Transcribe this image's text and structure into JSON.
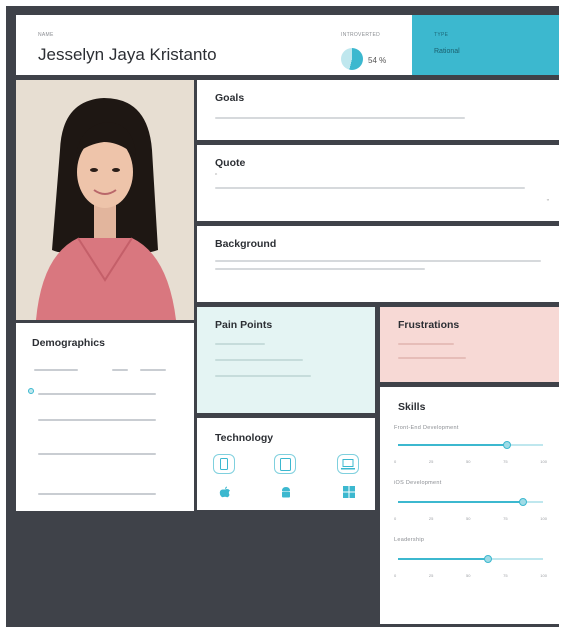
{
  "header": {
    "name_label": "NAME",
    "name": "Jesselyn Jaya Kristanto",
    "percent_label": "INTROVERTED",
    "percent": "54 %",
    "percent_value": 54,
    "type_label": "TYPE",
    "type_value": "Rational"
  },
  "goals": {
    "title": "Goals"
  },
  "quote": {
    "title": "Quote"
  },
  "background": {
    "title": "Background"
  },
  "pain_points": {
    "title": "Pain Points"
  },
  "frustrations": {
    "title": "Frustrations"
  },
  "demographics": {
    "title": "Demographics"
  },
  "technology": {
    "title": "Technology",
    "devices": [
      "phone-icon",
      "tablet-icon",
      "laptop-icon"
    ],
    "platforms": [
      "apple-icon",
      "android-icon",
      "windows-icon"
    ]
  },
  "skills": {
    "title": "Skills",
    "items": [
      {
        "label": "Front-End Development",
        "level": 0.75
      },
      {
        "label": "iOS Development",
        "level": 0.86
      },
      {
        "label": "Leadership",
        "level": 0.62
      }
    ],
    "ticks": [
      "0",
      "25",
      "50",
      "75",
      "100"
    ]
  },
  "colors": {
    "accent": "#3cb8cf",
    "board": "#3f4249",
    "pain_bg": "#e4f4f3",
    "frustration_bg": "#f7d9d5"
  }
}
